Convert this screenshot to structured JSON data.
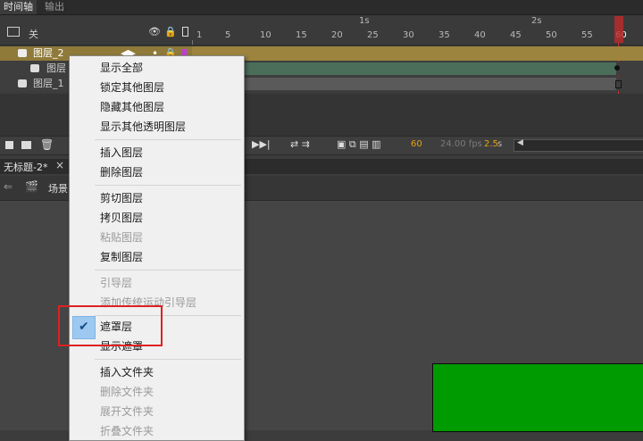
{
  "tabs": {
    "timeline": "时间轴",
    "output": "输出"
  },
  "header": {
    "layer_col": "关"
  },
  "ruler": {
    "sec_labels": [
      "1s",
      "2s"
    ],
    "frames": [
      "1",
      "5",
      "10",
      "15",
      "20",
      "25",
      "30",
      "35",
      "40",
      "45",
      "50",
      "55",
      "60"
    ]
  },
  "layers": [
    {
      "name": "图层_2"
    },
    {
      "name": "图层"
    },
    {
      "name": "图层_1"
    }
  ],
  "toolbar": {
    "frame": "60",
    "fps": "24.00 fps",
    "time": "2.5",
    "time_unit": "s"
  },
  "doc": {
    "title": "无标题-2*",
    "close": "×",
    "scene": "场景"
  },
  "menu": {
    "items": [
      {
        "label": "显示全部",
        "disabled": false
      },
      {
        "label": "锁定其他图层",
        "disabled": false
      },
      {
        "label": "隐藏其他图层",
        "disabled": false
      },
      {
        "label": "显示其他透明图层",
        "disabled": false
      },
      {
        "label": "插入图层",
        "disabled": false
      },
      {
        "label": "删除图层",
        "disabled": false
      },
      {
        "label": "剪切图层",
        "disabled": false
      },
      {
        "label": "拷贝图层",
        "disabled": false
      },
      {
        "label": "粘贴图层",
        "disabled": true
      },
      {
        "label": "复制图层",
        "disabled": false
      },
      {
        "label": "引导层",
        "disabled": true
      },
      {
        "label": "添加传统运动引导层",
        "disabled": true
      },
      {
        "label": "遮罩层",
        "disabled": false,
        "checked": true
      },
      {
        "label": "显示遮罩",
        "disabled": false
      },
      {
        "label": "插入文件夹",
        "disabled": false
      },
      {
        "label": "删除文件夹",
        "disabled": true
      },
      {
        "label": "展开文件夹",
        "disabled": true
      },
      {
        "label": "折叠文件夹",
        "disabled": true
      }
    ]
  },
  "colors": {
    "selected_layer": "#8f7a3a",
    "menu_bg": "#f0f0f0",
    "highlight": "#e02020",
    "green_fill": "#009b00"
  }
}
